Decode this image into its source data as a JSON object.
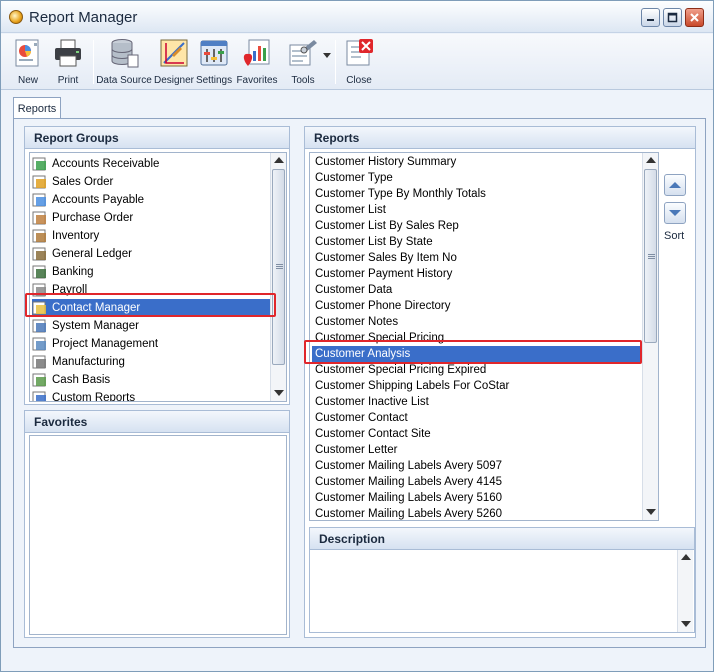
{
  "window": {
    "title": "Report Manager"
  },
  "toolbar": {
    "new_label": "New",
    "print_label": "Print",
    "datasource_label": "Data Source",
    "designer_label": "Designer",
    "settings_label": "Settings",
    "favorites_label": "Favorites",
    "tools_label": "Tools",
    "close_label": "Close"
  },
  "tabs": {
    "reports_label": "Reports"
  },
  "report_groups": {
    "title": "Report Groups",
    "items": [
      {
        "label": "Accounts Receivable",
        "icon": "accounts-receivable-icon"
      },
      {
        "label": "Sales Order",
        "icon": "sales-order-icon"
      },
      {
        "label": "Accounts Payable",
        "icon": "accounts-payable-icon"
      },
      {
        "label": "Purchase Order",
        "icon": "purchase-order-icon"
      },
      {
        "label": "Inventory",
        "icon": "inventory-icon"
      },
      {
        "label": "General Ledger",
        "icon": "general-ledger-icon"
      },
      {
        "label": "Banking",
        "icon": "banking-icon"
      },
      {
        "label": "Payroll",
        "icon": "payroll-icon"
      },
      {
        "label": "Contact Manager",
        "icon": "contact-manager-icon"
      },
      {
        "label": "System Manager",
        "icon": "system-manager-icon"
      },
      {
        "label": "Project Management",
        "icon": "project-management-icon"
      },
      {
        "label": "Manufacturing",
        "icon": "manufacturing-icon"
      },
      {
        "label": "Cash Basis",
        "icon": "cash-basis-icon"
      },
      {
        "label": "Custom Reports",
        "icon": "custom-reports-icon"
      }
    ],
    "selected": "Contact Manager"
  },
  "favorites": {
    "title": "Favorites"
  },
  "reports": {
    "title": "Reports",
    "items": [
      "Customer History Summary",
      "Customer Type",
      "Customer Type By Monthly Totals",
      "Customer List",
      "Customer List By Sales Rep",
      "Customer List By State",
      "Customer Sales By Item No",
      "Customer Payment History",
      "Customer Data",
      "Customer Phone Directory",
      "Customer Notes",
      "Customer Special Pricing",
      "Customer Analysis",
      "Customer Special Pricing Expired",
      "Customer Shipping Labels For CoStar",
      "Customer Inactive List",
      "Customer Contact",
      "Customer Contact Site",
      "Customer Letter",
      "Customer Mailing Labels Avery 5097",
      "Customer Mailing Labels Avery 4145",
      "Customer Mailing Labels Avery 5160",
      "Customer Mailing Labels Avery 5260"
    ],
    "selected": "Customer Analysis"
  },
  "sort": {
    "label": "Sort"
  },
  "description": {
    "title": "Description"
  },
  "colors": {
    "selection": "#3a6ec9",
    "highlight": "#e0262b",
    "panel_header": "#d6e2f1"
  }
}
